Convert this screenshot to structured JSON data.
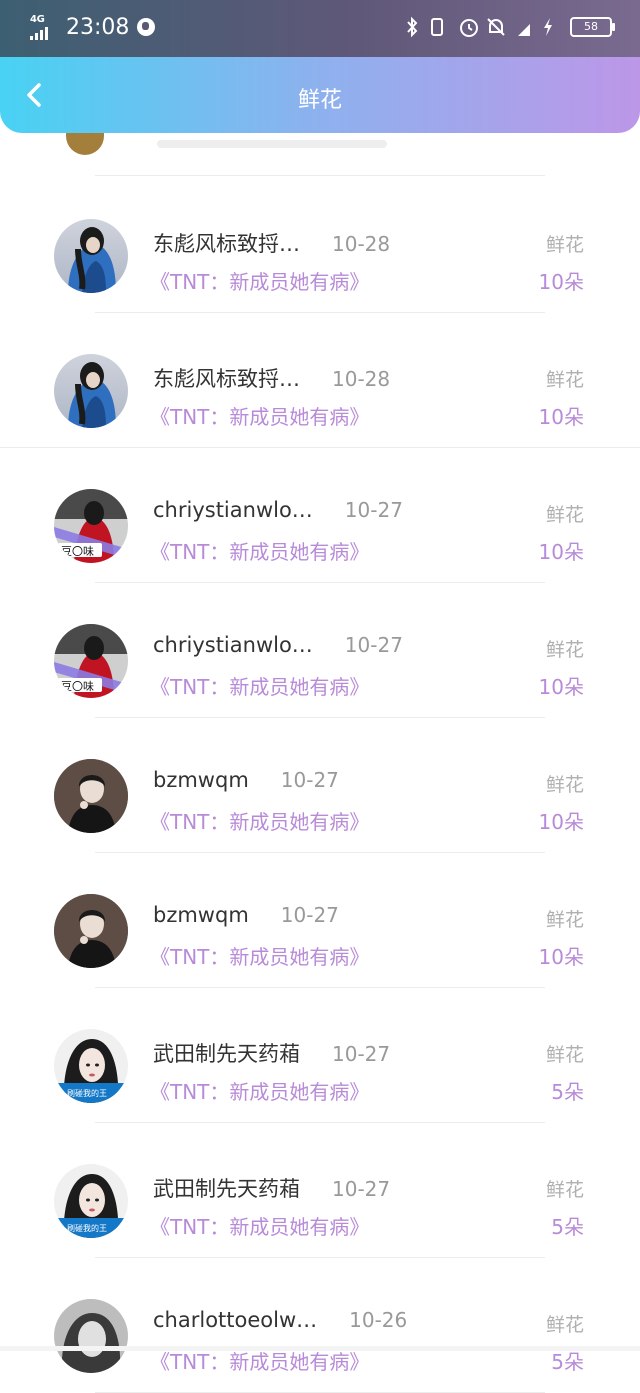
{
  "status": {
    "network": "4G",
    "time": "23:08",
    "battery": "58"
  },
  "header": {
    "title": "鲜花"
  },
  "rows": [
    {
      "name": "东彪风标致捋…",
      "date": "10-28",
      "book": "《TNT：新成员她有病》",
      "flower": "鲜花",
      "count": "10朵",
      "avatar": "blue-hood"
    },
    {
      "name": "东彪风标致捋…",
      "date": "10-28",
      "book": "《TNT：新成员她有病》",
      "flower": "鲜花",
      "count": "10朵",
      "avatar": "blue-hood"
    },
    {
      "name": "chriystianwlo…",
      "date": "10-27",
      "book": "《TNT：新成员她有病》",
      "flower": "鲜花",
      "count": "10朵",
      "avatar": "red-girl"
    },
    {
      "name": "chriystianwlo…",
      "date": "10-27",
      "book": "《TNT：新成员她有病》",
      "flower": "鲜花",
      "count": "10朵",
      "avatar": "red-girl"
    },
    {
      "name": "bzmwqm",
      "date": "10-27",
      "book": "《TNT：新成员她有病》",
      "flower": "鲜花",
      "count": "10朵",
      "avatar": "dark-boy"
    },
    {
      "name": "bzmwqm",
      "date": "10-27",
      "book": "《TNT：新成员她有病》",
      "flower": "鲜花",
      "count": "10朵",
      "avatar": "dark-boy"
    },
    {
      "name": "武田制先天药葙",
      "date": "10-27",
      "book": "《TNT：新成员她有病》",
      "flower": "鲜花",
      "count": "5朵",
      "avatar": "girl-caption"
    },
    {
      "name": "武田制先天药葙",
      "date": "10-27",
      "book": "《TNT：新成员她有病》",
      "flower": "鲜花",
      "count": "5朵",
      "avatar": "girl-caption"
    },
    {
      "name": "charlottoeolw…",
      "date": "10-26",
      "book": "《TNT：新成员她有病》",
      "flower": "鲜花",
      "count": "5朵",
      "avatar": "gray-girl"
    }
  ],
  "avatar_captions": {
    "red_girl": "豆〇味",
    "girl_caption": "刷碰我的王"
  }
}
